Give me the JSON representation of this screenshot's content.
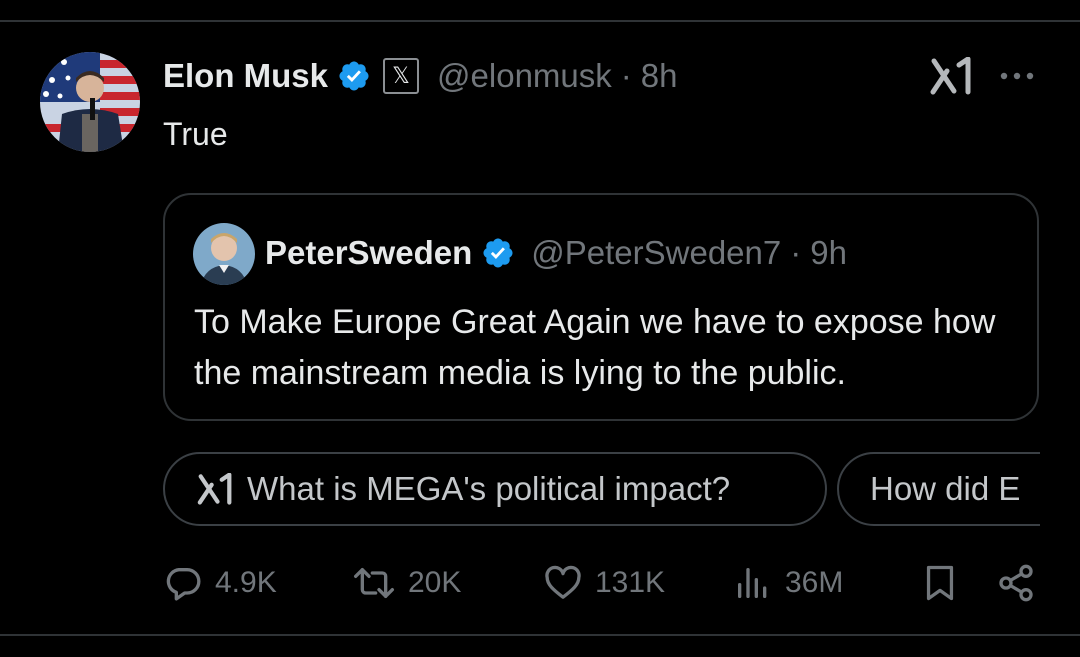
{
  "tweet": {
    "author_name": "Elon Musk",
    "handle": "@elonmusk",
    "separator": "·",
    "time": "8h",
    "text": "True",
    "avatar_icon": "avatar-photo",
    "verified_color": "#1d9bf0"
  },
  "quote": {
    "author_name": "PeterSweden",
    "handle": "@PeterSweden7",
    "separator": "·",
    "time": "9h",
    "text": "To Make Europe Great Again we have to expose how the mainstream media is lying to the public."
  },
  "grok_prompts": [
    {
      "label": "What is MEGA's political impact?",
      "icon": "grok-icon"
    },
    {
      "label": "How did E",
      "icon": null
    }
  ],
  "stats": {
    "replies": "4.9K",
    "reposts": "20K",
    "likes": "131K",
    "views": "36M"
  },
  "colors": {
    "background": "#000000",
    "text": "#e7e9ea",
    "muted": "#71767b",
    "border": "#2f3336",
    "verified": "#1d9bf0"
  }
}
